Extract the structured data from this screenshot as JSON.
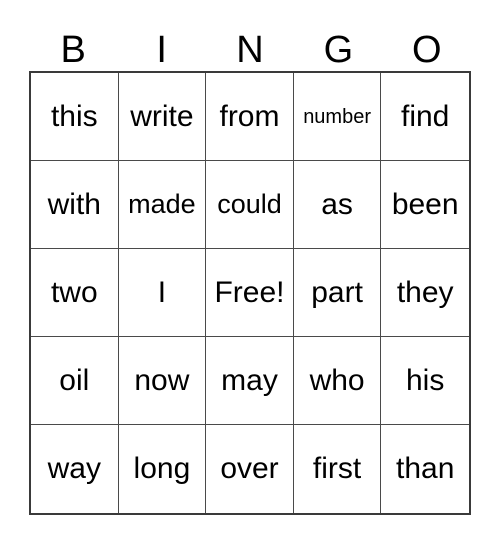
{
  "card": {
    "title": "BINGO",
    "background_color": "#ffffff",
    "text_color": "#000000",
    "grid_line_color": "#4a4a4a",
    "border_color": "#3a3a3a"
  },
  "header": {
    "letters": [
      "B",
      "I",
      "N",
      "G",
      "O"
    ]
  },
  "grid": {
    "columns": 5,
    "rows": 5,
    "free_space": {
      "row": 2,
      "column": 2,
      "label": "Free!"
    },
    "cells": [
      [
        {
          "text": "this",
          "size": "normal"
        },
        {
          "text": "write",
          "size": "normal"
        },
        {
          "text": "from",
          "size": "normal"
        },
        {
          "text": "number",
          "size": "xs"
        },
        {
          "text": "find",
          "size": "normal"
        }
      ],
      [
        {
          "text": "with",
          "size": "normal"
        },
        {
          "text": "made",
          "size": "sm"
        },
        {
          "text": "could",
          "size": "sm"
        },
        {
          "text": "as",
          "size": "normal"
        },
        {
          "text": "been",
          "size": "normal"
        }
      ],
      [
        {
          "text": "two",
          "size": "normal"
        },
        {
          "text": "I",
          "size": "normal"
        },
        {
          "text": "Free!",
          "size": "normal"
        },
        {
          "text": "part",
          "size": "normal"
        },
        {
          "text": "they",
          "size": "normal"
        }
      ],
      [
        {
          "text": "oil",
          "size": "normal"
        },
        {
          "text": "now",
          "size": "normal"
        },
        {
          "text": "may",
          "size": "normal"
        },
        {
          "text": "who",
          "size": "normal"
        },
        {
          "text": "his",
          "size": "normal"
        }
      ],
      [
        {
          "text": "way",
          "size": "normal"
        },
        {
          "text": "long",
          "size": "normal"
        },
        {
          "text": "over",
          "size": "normal"
        },
        {
          "text": "first",
          "size": "normal"
        },
        {
          "text": "than",
          "size": "normal"
        }
      ]
    ]
  }
}
